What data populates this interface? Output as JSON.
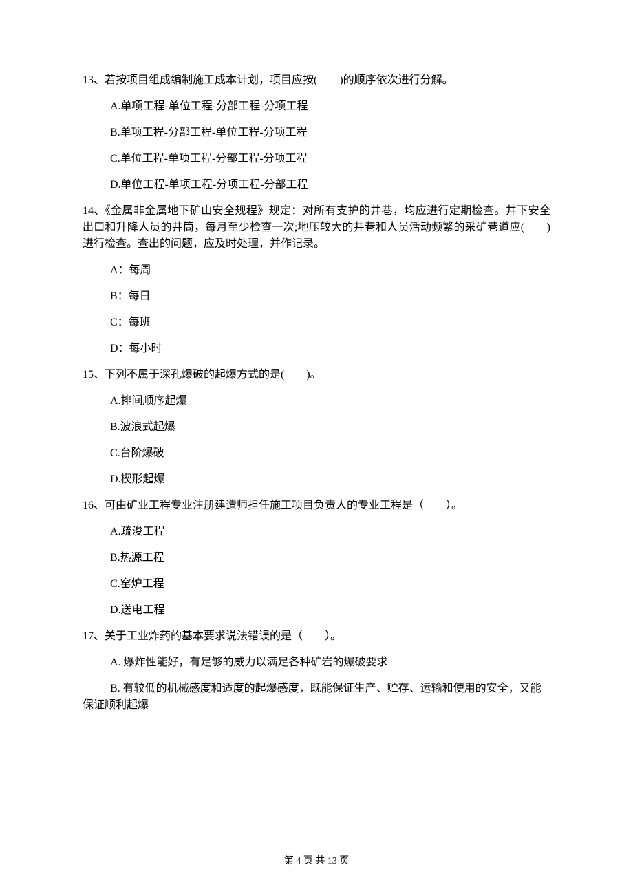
{
  "questions": [
    {
      "num": "13、",
      "text": "若按项目组成编制施工成本计划，项目应按(　　)的顺序依次进行分解。",
      "options": [
        "A.单项工程-单位工程-分部工程-分项工程",
        "B.单项工程-分部工程-单位工程-分项工程",
        "C.单位工程-单项工程-分部工程-分项工程",
        "D.单位工程-单项工程-分项工程-分部工程"
      ]
    },
    {
      "num": "14、",
      "text": "《金属非金属地下矿山安全规程》规定：对所有支护的井巷，均应进行定期检查。井下安全出口和升降人员的井筒，每月至少检查一次;地压较大的井巷和人员活动频繁的采矿巷道应(　　)进行检查。查出的问题，应及时处理，并作记录。",
      "options": [
        "A：每周",
        "B：每日",
        "C：每班",
        "D：每小时"
      ]
    },
    {
      "num": "15、",
      "text": "下列不属于深孔爆破的起爆方式的是(　　)。",
      "options": [
        "A.排间顺序起爆",
        "B.波浪式起爆",
        "C.台阶爆破",
        "D.楔形起爆"
      ]
    },
    {
      "num": "16、",
      "text": "可由矿业工程专业注册建造师担任施工项目负责人的专业工程是（　　）。",
      "options": [
        "A.疏浚工程",
        "B.热源工程",
        "C.窑炉工程",
        "D.送电工程"
      ]
    },
    {
      "num": "17、",
      "text": "关于工业炸药的基本要求说法错误的是（　　）。",
      "options": [
        "A. 爆炸性能好，有足够的威力以满足各种矿岩的爆破要求",
        "B. 有较低的机械感度和适度的起爆感度，既能保证生产、贮存、运输和使用的安全，又能保证顺利起爆"
      ]
    }
  ],
  "footer": "第 4 页 共 13 页"
}
